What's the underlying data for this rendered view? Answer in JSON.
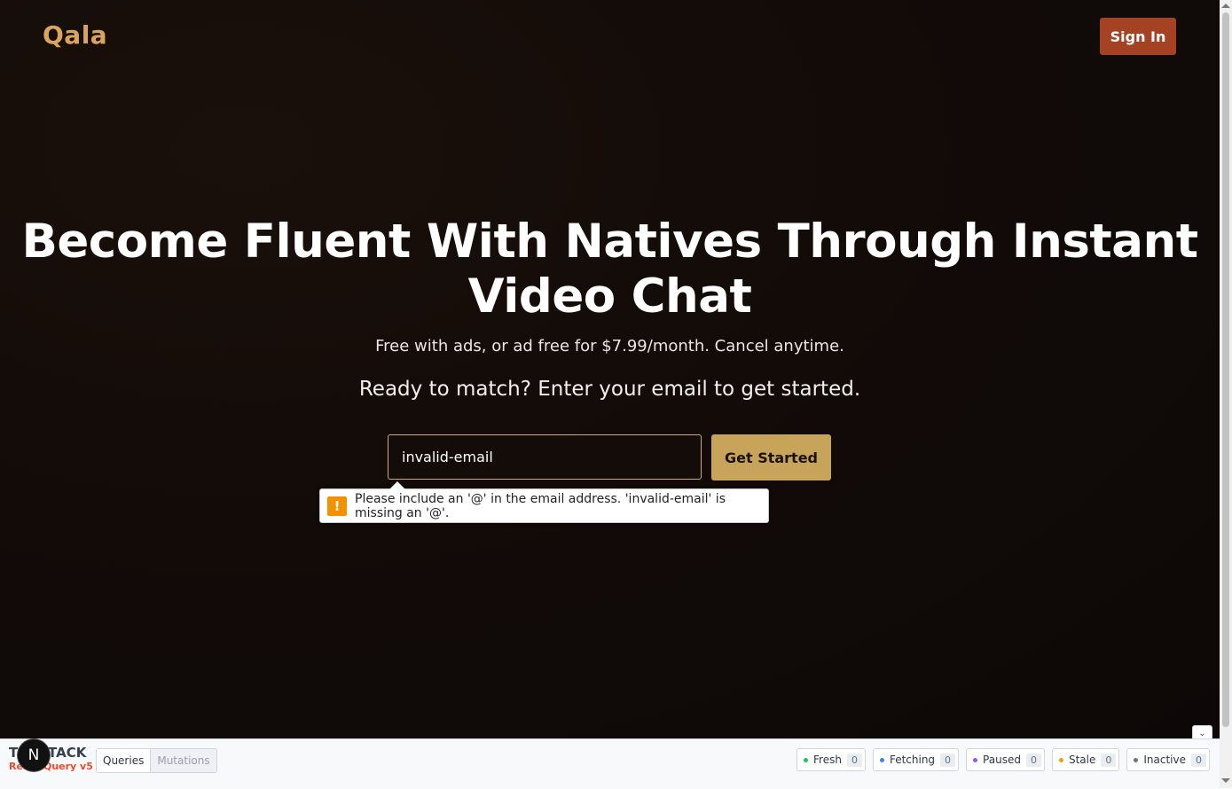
{
  "header": {
    "brand": "Qala",
    "sign_in_label": "Sign In"
  },
  "hero": {
    "headline": "Become Fluent With Natives Through Instant Video Chat",
    "subline": "Free with ads, or ad free for $7.99/month. Cancel anytime.",
    "prompt": "Ready to match? Enter your email to get started."
  },
  "form": {
    "email_value": "invalid-email",
    "submit_label": "Get Started",
    "validation_message": "Please include an '@' in the email address. 'invalid-email' is missing an '@'.",
    "warning_glyph": "!"
  },
  "devtools": {
    "logo_line1": "TANSTACK",
    "logo_line2": "React Query v5",
    "nextjs_badge": "N",
    "tabs": [
      "Queries",
      "Mutations"
    ],
    "statuses": [
      {
        "label": "Fresh",
        "count": "0",
        "color": "#22c55e"
      },
      {
        "label": "Fetching",
        "count": "0",
        "color": "#3b82f6"
      },
      {
        "label": "Paused",
        "count": "0",
        "color": "#8b5cf6"
      },
      {
        "label": "Stale",
        "count": "0",
        "color": "#f59e0b"
      },
      {
        "label": "Inactive",
        "count": "0",
        "color": "#6b7280"
      }
    ],
    "collapse_glyph": "⌄"
  },
  "colors": {
    "brand": "#d8a45e",
    "sign_in": "#a64224",
    "cta": "#c8a45a"
  }
}
